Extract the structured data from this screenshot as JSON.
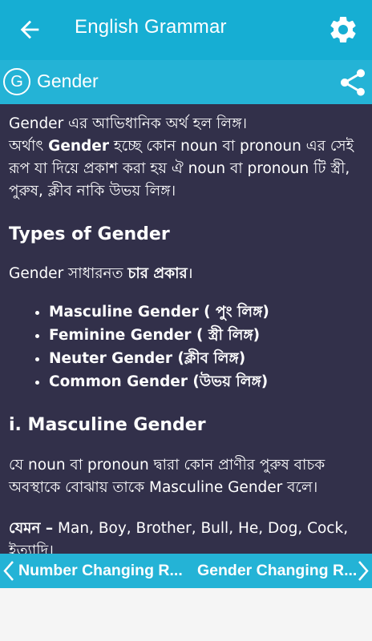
{
  "app_bar": {
    "title": "English Grammar",
    "back_icon": "arrow-left-icon",
    "settings_icon": "gear-icon",
    "color": "#16aed3"
  },
  "topic_bar": {
    "badge_letter": "G",
    "title": "Gender",
    "share_icon": "share-icon",
    "color": "#24b3d6"
  },
  "content": {
    "background": "#32304a",
    "intro": {
      "line1": "Gender এর আভিধানিক অর্থ হল লিঙ্গ।",
      "line2_prefix": "অর্থাৎ ",
      "line2_bold": "Gender",
      "line2_rest": " হচ্ছে কোন noun বা pronoun এর সেই রূপ যা দিয়ে প্রকাশ করা হয় ঐ noun বা pronoun টি স্ত্রী, পুরুষ, ক্লীব নাকি উভয় লিঙ্গ।"
    },
    "types_heading": "Types of Gender",
    "types_intro_prefix": "Gender সাধারনত ",
    "types_intro_bold": "চার প্রকার",
    "types_intro_suffix": "।",
    "types_list": [
      "Masculine Gender ( পুং লিঙ্গ)",
      "Feminine Gender ( স্ত্রী লিঙ্গ)",
      "Neuter Gender (ক্লীব লিঙ্গ)",
      "Common Gender (উভয় লিঙ্গ)"
    ],
    "masculine_heading": "i. Masculine Gender",
    "masculine_def": "যে noun বা pronoun দ্বারা কোন প্রাণীর পুরুষ বাচক অবস্থাকে বোঝায় তাকে Masculine Gender বলে।",
    "example_bold": "যেমন –",
    "example_text": " Man, Boy, Brother, Bull, He, Dog, Cock, ইত্যাদি।"
  },
  "nav_bar": {
    "prev_label": "Number Changing R...",
    "next_label": "Gender Changing R...",
    "prev_icon": "chevron-left-icon",
    "next_icon": "chevron-right-icon"
  }
}
